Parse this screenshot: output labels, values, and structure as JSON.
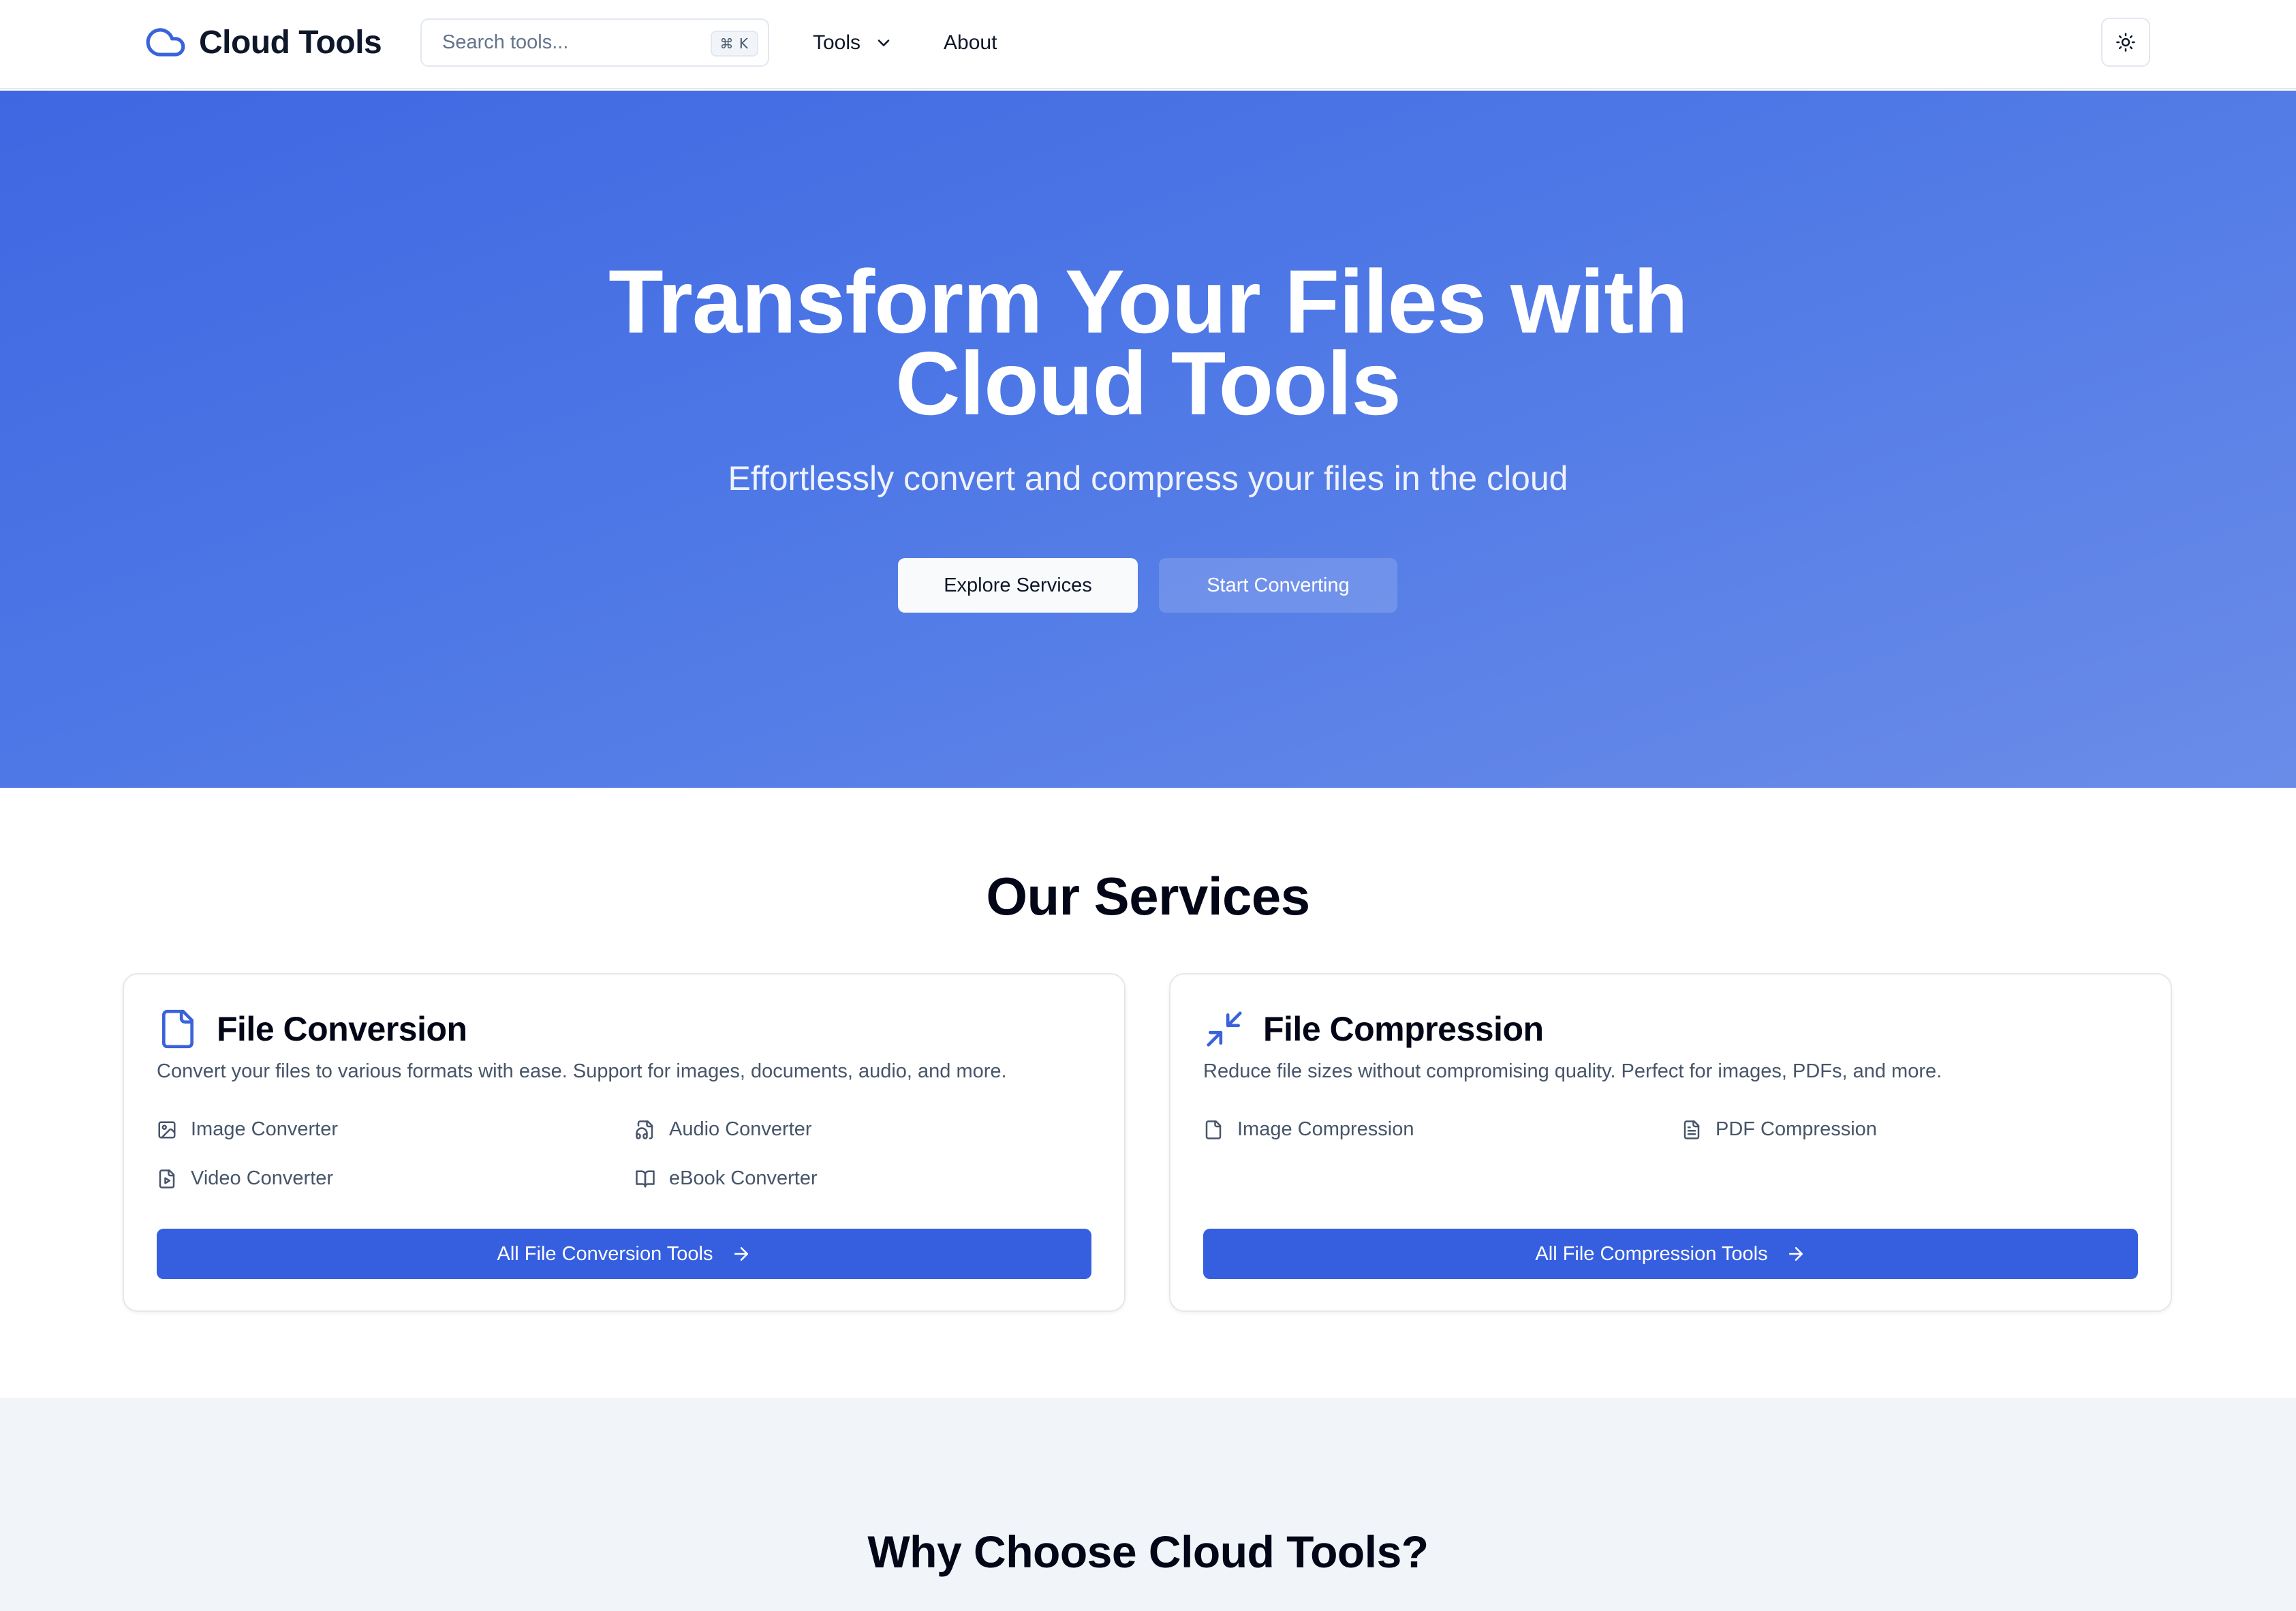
{
  "header": {
    "logo_text": "Cloud Tools",
    "search_placeholder": "Search tools...",
    "search_shortcut": "⌘ K",
    "nav_tools": "Tools",
    "nav_about": "About"
  },
  "hero": {
    "title_line1": "Transform Your Files with",
    "title_line2": "Cloud Tools",
    "subtitle": "Effortlessly convert and compress your files in the cloud",
    "explore_button": "Explore Services",
    "start_button": "Start Converting"
  },
  "services": {
    "title": "Our Services",
    "conversion": {
      "title": "File Conversion",
      "description": "Convert your files to various formats with ease. Support for images, documents, audio, and more.",
      "tools": [
        {
          "label": "Image Converter",
          "icon": "image-icon"
        },
        {
          "label": "Audio Converter",
          "icon": "file-audio-icon"
        },
        {
          "label": "Video Converter",
          "icon": "file-video-icon"
        },
        {
          "label": "eBook Converter",
          "icon": "book-open-icon"
        }
      ],
      "button": "All File Conversion Tools"
    },
    "compression": {
      "title": "File Compression",
      "description": "Reduce file sizes without compromising quality. Perfect for images, PDFs, and more.",
      "tools": [
        {
          "label": "Image Compression",
          "icon": "file-icon"
        },
        {
          "label": "PDF Compression",
          "icon": "file-text-icon"
        }
      ],
      "button": "All File Compression Tools"
    }
  },
  "why": {
    "title": "Why Choose Cloud Tools?"
  },
  "colors": {
    "accent": "#365fe0",
    "hero_start": "#3f67e2",
    "hero_end": "#6a8ce9",
    "section_bg": "#f1f5f9"
  }
}
